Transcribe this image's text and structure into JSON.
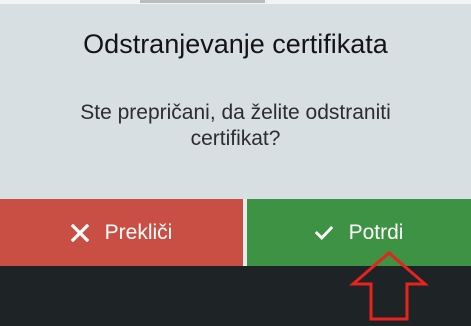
{
  "dialog": {
    "title": "Odstranjevanje certifikata",
    "message": "Ste prepričani, da želite odstraniti certifikat?"
  },
  "buttons": {
    "cancel": {
      "label": "Prekliči",
      "icon": "close-icon",
      "color": "#c94f45"
    },
    "confirm": {
      "label": "Potrdi",
      "icon": "checkmark-icon",
      "color": "#3e9243"
    }
  },
  "annotation": {
    "icon": "up-arrow-icon",
    "color": "#e8221d"
  }
}
